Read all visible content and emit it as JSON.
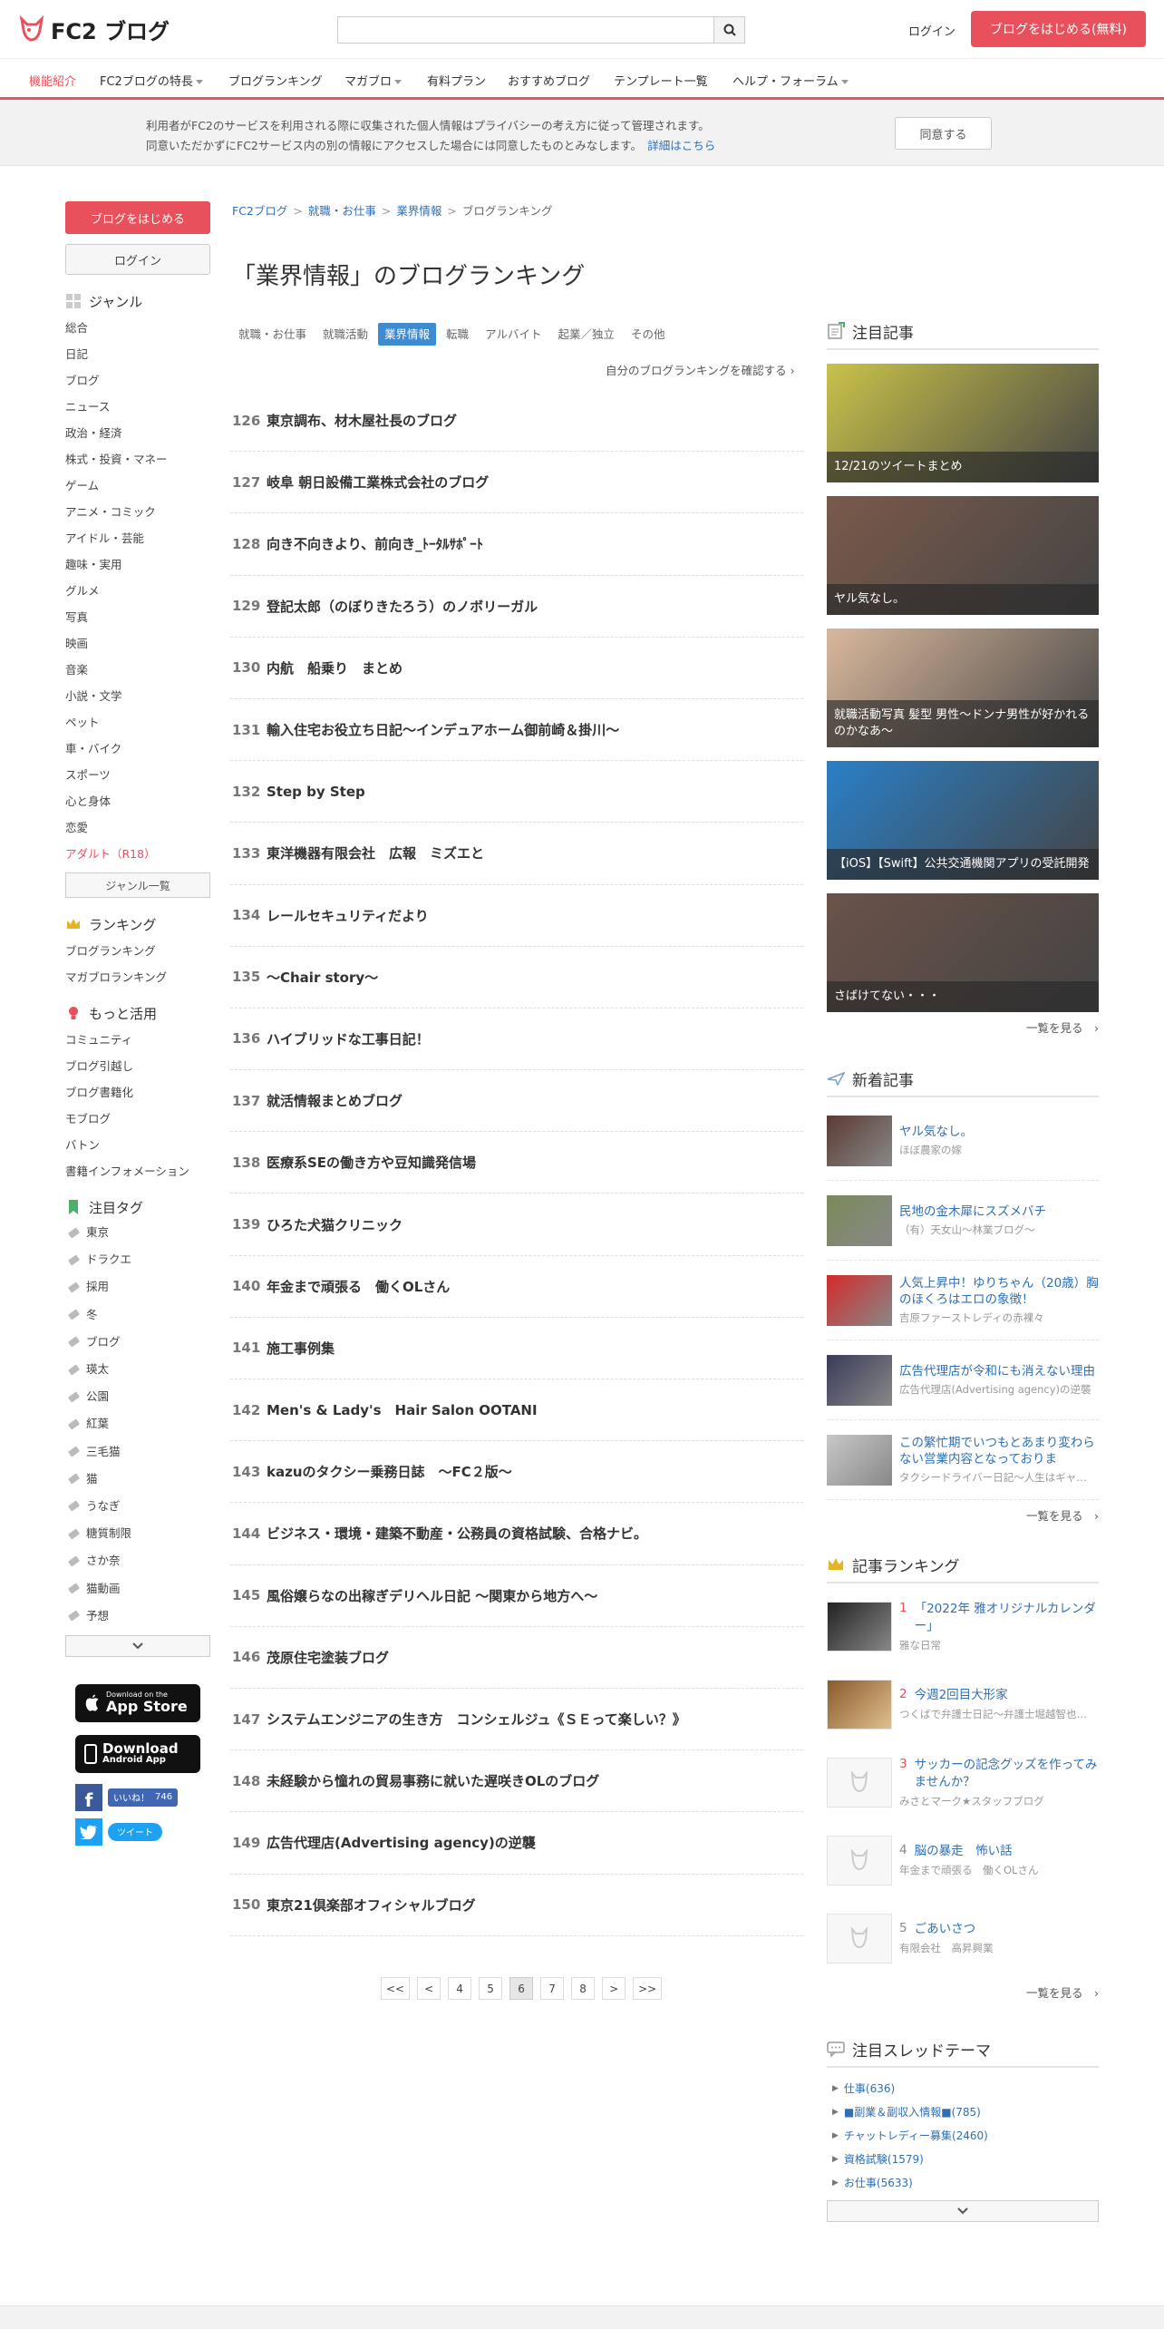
{
  "header": {
    "logo_text": "FC2 ブログ",
    "search_placeholder": "",
    "login": "ログイン",
    "start": "ブログをはじめる(無料)"
  },
  "nav": [
    {
      "label": "機能紹介",
      "active": true,
      "dropdown": false
    },
    {
      "label": "FC2ブログの特長",
      "active": false,
      "dropdown": true
    },
    {
      "label": "ブログランキング",
      "active": false,
      "dropdown": false
    },
    {
      "label": "マガブロ",
      "active": false,
      "dropdown": true
    },
    {
      "label": "有料プラン",
      "active": false,
      "dropdown": false
    },
    {
      "label": "おすすめブログ",
      "active": false,
      "dropdown": false
    },
    {
      "label": "テンプレート一覧",
      "active": false,
      "dropdown": false
    },
    {
      "label": "ヘルプ・フォーラム",
      "active": false,
      "dropdown": true
    }
  ],
  "notice": {
    "line1": "利用者がFC2のサービスを利用される際に収集された個人情報はプライバシーの考え方に従って管理されます。",
    "line2": "同意いただかずにFC2サービス内の別の情報にアクセスした場合には同意したものとみなします。",
    "link": "詳細はこちら",
    "agree": "同意する"
  },
  "left": {
    "start": "ブログをはじめる",
    "login": "ログイン",
    "genre_heading": "ジャンル",
    "genres": [
      "総合",
      "日記",
      "ブログ",
      "ニュース",
      "政治・経済",
      "株式・投資・マネー",
      "ゲーム",
      "アニメ・コミック",
      "アイドル・芸能",
      "趣味・実用",
      "グルメ",
      "写真",
      "映画",
      "音楽",
      "小説・文学",
      "ペット",
      "車・バイク",
      "スポーツ",
      "心と身体",
      "恋愛"
    ],
    "adult": "アダルト（R18）",
    "genre_all": "ジャンル一覧",
    "ranking_heading": "ランキング",
    "ranking_links": [
      "ブログランキング",
      "マガブロランキング"
    ],
    "more_heading": "もっと活用",
    "more_links": [
      "コミュニティ",
      "ブログ引越し",
      "ブログ書籍化",
      "モブログ",
      "バトン",
      "書籍インフォメーション"
    ],
    "tag_heading": "注目タグ",
    "tags": [
      "東京",
      "ドラクエ",
      "採用",
      "冬",
      "ブログ",
      "瑛太",
      "公園",
      "紅葉",
      "三毛猫",
      "猫",
      "うなぎ",
      "糖質制限",
      "さか奈",
      "猫動画",
      "予想"
    ],
    "appstore_small": "Download on the",
    "appstore_big": "App Store",
    "android_big": "Download",
    "android_small": "Android App",
    "like_label": "いいね！",
    "like_count": "746",
    "tweet": "ツイート"
  },
  "main": {
    "breadcrumb": [
      "FC2ブログ",
      "就職・お仕事",
      "業界情報",
      "ブログランキング"
    ],
    "title": "「業界情報」のブログランキング",
    "tabs": [
      "就職・お仕事",
      "就職活動",
      "業界情報",
      "転職",
      "アルバイト",
      "起業／独立",
      "その他"
    ],
    "active_tab": 2,
    "my_ranking": "自分のブログランキングを確認する",
    "rankings": [
      {
        "rank": "126",
        "title": "東京調布、材木屋社長のブログ"
      },
      {
        "rank": "127",
        "title": "岐阜 朝日設備工業株式会社のブログ"
      },
      {
        "rank": "128",
        "title": "向き不向きより、前向き_ﾄｰﾀﾙｻﾎﾟｰﾄ"
      },
      {
        "rank": "129",
        "title": "登記太郎（のぼりきたろう）のノボリーガル"
      },
      {
        "rank": "130",
        "title": "内航　船乗り　まとめ"
      },
      {
        "rank": "131",
        "title": "輸入住宅お役立ち日記～インデュアホーム御前崎＆掛川～"
      },
      {
        "rank": "132",
        "title": "Step by Step"
      },
      {
        "rank": "133",
        "title": "東洋機器有限会社　広報　ミズエと"
      },
      {
        "rank": "134",
        "title": "レールセキュリティだより"
      },
      {
        "rank": "135",
        "title": "～Chair story～"
      },
      {
        "rank": "136",
        "title": "ハイブリッドな工事日記！"
      },
      {
        "rank": "137",
        "title": "就活情報まとめブログ"
      },
      {
        "rank": "138",
        "title": "医療系SEの働き方や豆知識発信場"
      },
      {
        "rank": "139",
        "title": "ひろた犬猫クリニック"
      },
      {
        "rank": "140",
        "title": "年金まで頑張る　働くOLさん"
      },
      {
        "rank": "141",
        "title": "施工事例集"
      },
      {
        "rank": "142",
        "title": "Men's & Lady's　Hair Salon OOTANI"
      },
      {
        "rank": "143",
        "title": "kazuのタクシー乗務日誌　～FC２版～"
      },
      {
        "rank": "144",
        "title": "ビジネス・環境・建築不動産・公務員の資格試験、合格ナビ。"
      },
      {
        "rank": "145",
        "title": "風俗嬢らなの出稼ぎデリヘル日記 ～関東から地方へ～"
      },
      {
        "rank": "146",
        "title": "茂原住宅塗装ブログ"
      },
      {
        "rank": "147",
        "title": "システムエンジニアの生き方　コンシェルジュ《ＳＥって楽しい？》"
      },
      {
        "rank": "148",
        "title": "未経験から憧れの貿易事務に就いた遅咲きOLのブログ"
      },
      {
        "rank": "149",
        "title": "広告代理店(Advertising agency)の逆襲"
      },
      {
        "rank": "150",
        "title": "東京21倶楽部オフィシャルブログ"
      }
    ],
    "pager": [
      "<<",
      "<",
      "4",
      "5",
      "6",
      "7",
      "8",
      ">",
      ">>"
    ],
    "current_page": "6"
  },
  "right": {
    "featured_heading": "注目記事",
    "featured": [
      {
        "caption": "12/21のツイートまとめ",
        "color": "#c9c24a"
      },
      {
        "caption": "ヤル気なし。",
        "color": "#7a5a4a"
      },
      {
        "caption": "就職活動写真 髪型 男性～ドンナ男性が好かれるのかなあ～",
        "color": "#d9b89c"
      },
      {
        "caption": "【iOS】【Swift】公共交通機関アプリの受託開発",
        "color": "#2a7fc6"
      },
      {
        "caption": "さばけてない・・・",
        "color": "#6a5248"
      }
    ],
    "more": "一覧を見る",
    "new_heading": "新着記事",
    "new_articles": [
      {
        "title": "ヤル気なし。",
        "sub": "ほぼ農家の嫁",
        "color": "#5b3b33"
      },
      {
        "title": "民地の金木犀にスズメバチ",
        "sub": "（有）天女山～林業ブログ～",
        "color": "#7a8a5a"
      },
      {
        "title": "人気上昇中！ゆりちゃん（20歳）胸のほくろはエロの象徴！",
        "sub": "吉原ファーストレディの赤裸々",
        "color": "#d42a2a"
      },
      {
        "title": "広告代理店が令和にも消えない理由",
        "sub": "広告代理店(Advertising agency)の逆襲",
        "color": "#3a3a5a"
      },
      {
        "title": "この繁忙期でいつもとあまり変わらない営業内容となっておりま",
        "sub": "タクシードライバー日記～人生はギャ…",
        "color": "#c8c8c8"
      }
    ],
    "ranking_heading": "記事ランキング",
    "article_ranking": [
      {
        "rank": "1",
        "title": "「2022年 雅オリジナルカレンダー」",
        "sub": "雅な日常",
        "has_img": true
      },
      {
        "rank": "2",
        "title": "今週2回目大形家",
        "sub": "つくばで弁護士日記～弁護士堀越智也…",
        "has_img": true
      },
      {
        "rank": "3",
        "title": "サッカーの記念グッズを作ってみませんか？",
        "sub": "みさとマーク★スタッフブログ",
        "has_img": false
      },
      {
        "rank": "4",
        "title": "脳の暴走　怖い話",
        "sub": "年金まで頑張る　働くOLさん",
        "has_img": false
      },
      {
        "rank": "5",
        "title": "ごあいさつ",
        "sub": "有限会社　高昇興業",
        "has_img": false
      }
    ],
    "thread_heading": "注目スレッドテーマ",
    "threads": [
      "仕事(636)",
      "■副業＆副収入情報■(785)",
      "チャットレディー募集(2460)",
      "資格試験(1579)",
      "お仕事(5633)"
    ]
  },
  "colors": {
    "accent": "#e8505b",
    "link": "#2f6fb5",
    "tab_active": "#3d8bd1"
  }
}
